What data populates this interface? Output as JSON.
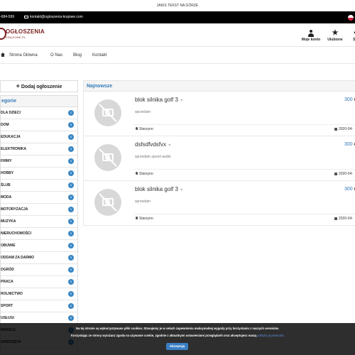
{
  "promo": "JAKIS TEKST NA GÓRZE",
  "topbar": {
    "phone": "-684-599",
    "email": "kontakt@ogloszenia-krajowe.com"
  },
  "logo": {
    "line1": "OGŁOSZENIA",
    "line2": "KRAJOWE.PL"
  },
  "header_actions": {
    "account": "Moje konto",
    "favorites": "Ulubione",
    "cart": "Sz"
  },
  "nav": {
    "home": "Strona Główna",
    "about": "O Nas",
    "blog": "Blog",
    "contact": "Kontakt"
  },
  "sidebar": {
    "add_button": "Dodaj ogłoszenie",
    "heading": "egorie",
    "categories": [
      {
        "label": "DLA DZIECI",
        "count": "1"
      },
      {
        "label": "DOM",
        "count": "0"
      },
      {
        "label": "EDUKACJA",
        "count": "0"
      },
      {
        "label": "ELEKTRONIKA",
        "count": "1"
      },
      {
        "label": "FIRMY",
        "count": "0"
      },
      {
        "label": "HOBBY",
        "count": "0"
      },
      {
        "label": "ŚLUB",
        "count": "0"
      },
      {
        "label": "MODA",
        "count": "0"
      },
      {
        "label": "MOTORYZACJA",
        "count": "1"
      },
      {
        "label": "MUZYKA",
        "count": "0"
      },
      {
        "label": "NIERUCHOMOŚCI",
        "count": "0"
      },
      {
        "label": "OBUWIE",
        "count": "0"
      },
      {
        "label": "ODDAM ZA DARMO",
        "count": "0"
      },
      {
        "label": "OGRÓD",
        "count": "0"
      },
      {
        "label": "PRACA",
        "count": "0"
      },
      {
        "label": "ROLNICTWO",
        "count": "0"
      },
      {
        "label": "SPORT",
        "count": "0"
      },
      {
        "label": "USŁUGI",
        "count": "0"
      },
      {
        "label": "WESELE",
        "count": "0"
      },
      {
        "label": "ZWIERZĘTA",
        "count": "0"
      }
    ]
  },
  "main": {
    "heading": "Najnowsze",
    "listings": [
      {
        "title": "blok silnika golf 3",
        "description": "sprzedam",
        "price": "300",
        "location": "Starzyno",
        "date": "2020-04-"
      },
      {
        "title": "dsfsdfvdsfvx",
        "description": "sprzedam sprzet audio",
        "price": "300",
        "location": "Starzyno",
        "date": "2020-04-"
      },
      {
        "title": "blok silnika golf 3",
        "description": "sprzedam",
        "price": "300",
        "location": "Starzyno",
        "date": "2020-04-"
      }
    ]
  },
  "cookie": {
    "line1": "Na tej stronie są wykorzystywane pliki cookies. Stosujemy je w celach zapewnienia maksymalnej wygody przy korzystaniu z naszych serwisów.",
    "line2": "Korzystając ze strony wyrażasz zgodę na używanie cookie, zgodnie z aktualnymi ustawieniami przeglądarki oraz akceptujesz naszą",
    "link": "politykę prywatności",
    "accept": "Akceptuję"
  },
  "colors": {
    "accent": "#337ab7",
    "badge": "#3a87c4",
    "brand": "#7a1e1e"
  }
}
